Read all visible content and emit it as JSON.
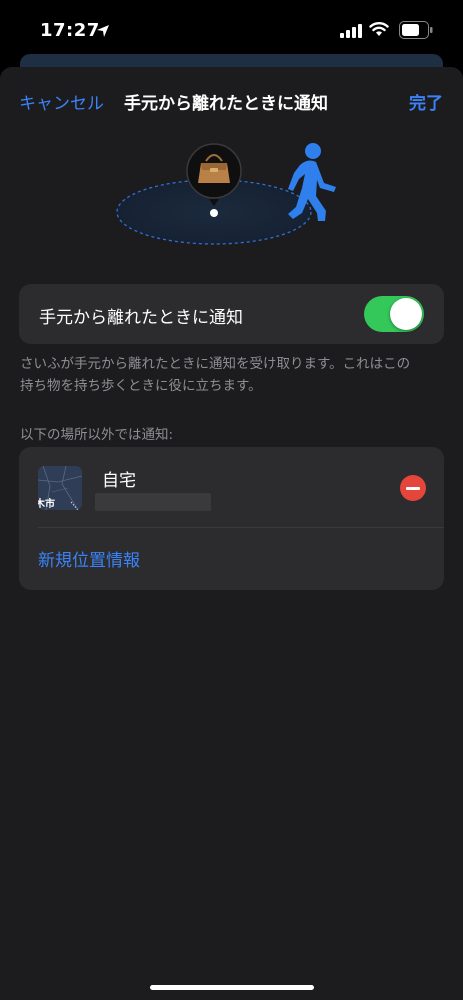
{
  "status": {
    "time": "17:27"
  },
  "nav": {
    "cancel": "キャンセル",
    "title": "手元から離れたときに通知",
    "done": "完了"
  },
  "toggle": {
    "label": "手元から離れたときに通知",
    "on": true
  },
  "footnote": {
    "line1": "さいふが手元から離れたときに通知を受け取ります。これはこの",
    "line2": "持ち物を持ち歩くときに役に立ちます。"
  },
  "places": {
    "header": "以下の場所以外では通知:",
    "items": [
      {
        "name": "自宅",
        "map_label": "木市"
      }
    ],
    "new_location": "新規位置情報"
  },
  "colors": {
    "accent": "#3b82f6",
    "switch_on": "#34c759",
    "remove": "#e5453b"
  }
}
